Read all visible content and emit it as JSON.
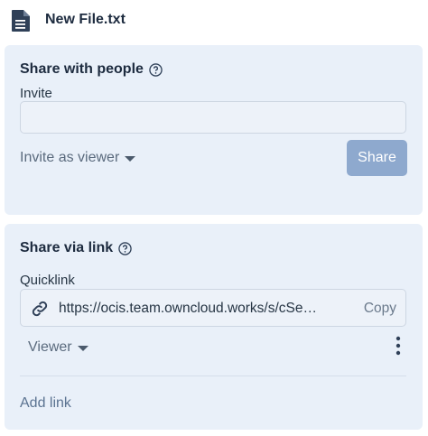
{
  "file": {
    "name": "New File.txt",
    "icon": "text-file-icon"
  },
  "share_people": {
    "title": "Share with people",
    "invite_label": "Invite",
    "invite_value": "",
    "invite_placeholder": "",
    "role_label": "Invite as viewer",
    "share_label": "Share"
  },
  "share_link": {
    "title": "Share via link",
    "quicklink_label": "Quicklink",
    "url": "https://ocis.team.owncloud.works/s/cSehHz...",
    "copy_label": "Copy",
    "role_label": "Viewer",
    "add_link_label": "Add link"
  },
  "colors": {
    "panel_bg": "#e9f0f9",
    "share_button_bg": "#8ea9ce",
    "heading": "#1d2b3f"
  }
}
